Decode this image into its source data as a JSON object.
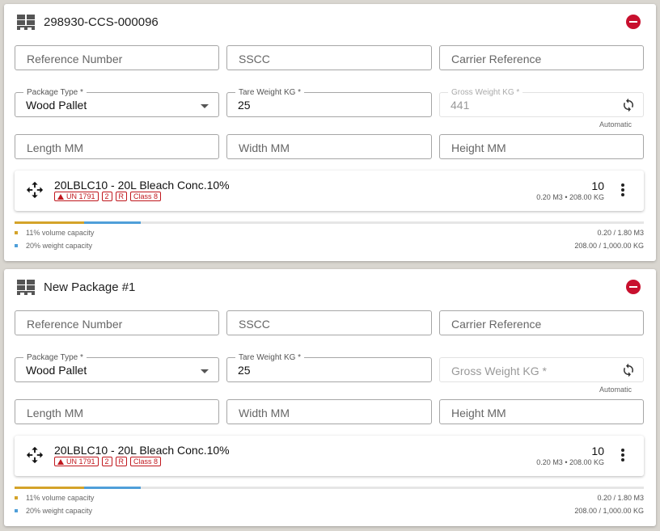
{
  "labels": {
    "reference_number": "Reference Number",
    "sscc": "SSCC",
    "carrier_reference": "Carrier Reference",
    "package_type": "Package Type *",
    "tare_weight": "Tare Weight KG *",
    "gross_weight": "Gross Weight KG *",
    "length": "Length MM",
    "width": "Width MM",
    "height": "Height MM",
    "automatic": "Automatic"
  },
  "colors": {
    "remove": "#c8102e",
    "hazard": "#c0171d",
    "volume_bar": "#d4a32a",
    "weight_bar": "#4f9fd9"
  },
  "packages": [
    {
      "title": "298930-CCS-000096",
      "package_type": "Wood Pallet",
      "tare_weight": "25",
      "gross_weight": "441",
      "item": {
        "name": "20LBLC10 - 20L Bleach Conc.10%",
        "badges": [
          "UN 1791",
          "2",
          "R",
          "Class 8"
        ],
        "quantity": "10",
        "dims": "0.20 M3 • 208.00 KG"
      },
      "volume_fraction": 0.11,
      "weight_fraction": 0.2,
      "volume_label": "11% volume capacity",
      "weight_label": "20% weight capacity",
      "volume_value": "0.20 / 1.80 M3",
      "weight_value": "208.00 / 1,000.00 KG"
    },
    {
      "title": "New Package #1",
      "package_type": "Wood Pallet",
      "tare_weight": "25",
      "gross_weight": "",
      "item": {
        "name": "20LBLC10 - 20L Bleach Conc.10%",
        "badges": [
          "UN 1791",
          "2",
          "R",
          "Class 8"
        ],
        "quantity": "10",
        "dims": "0.20 M3 • 208.00 KG"
      },
      "volume_fraction": 0.11,
      "weight_fraction": 0.2,
      "volume_label": "11% volume capacity",
      "weight_label": "20% weight capacity",
      "volume_value": "0.20 / 1.80 M3",
      "weight_value": "208.00 / 1,000.00 KG"
    }
  ]
}
